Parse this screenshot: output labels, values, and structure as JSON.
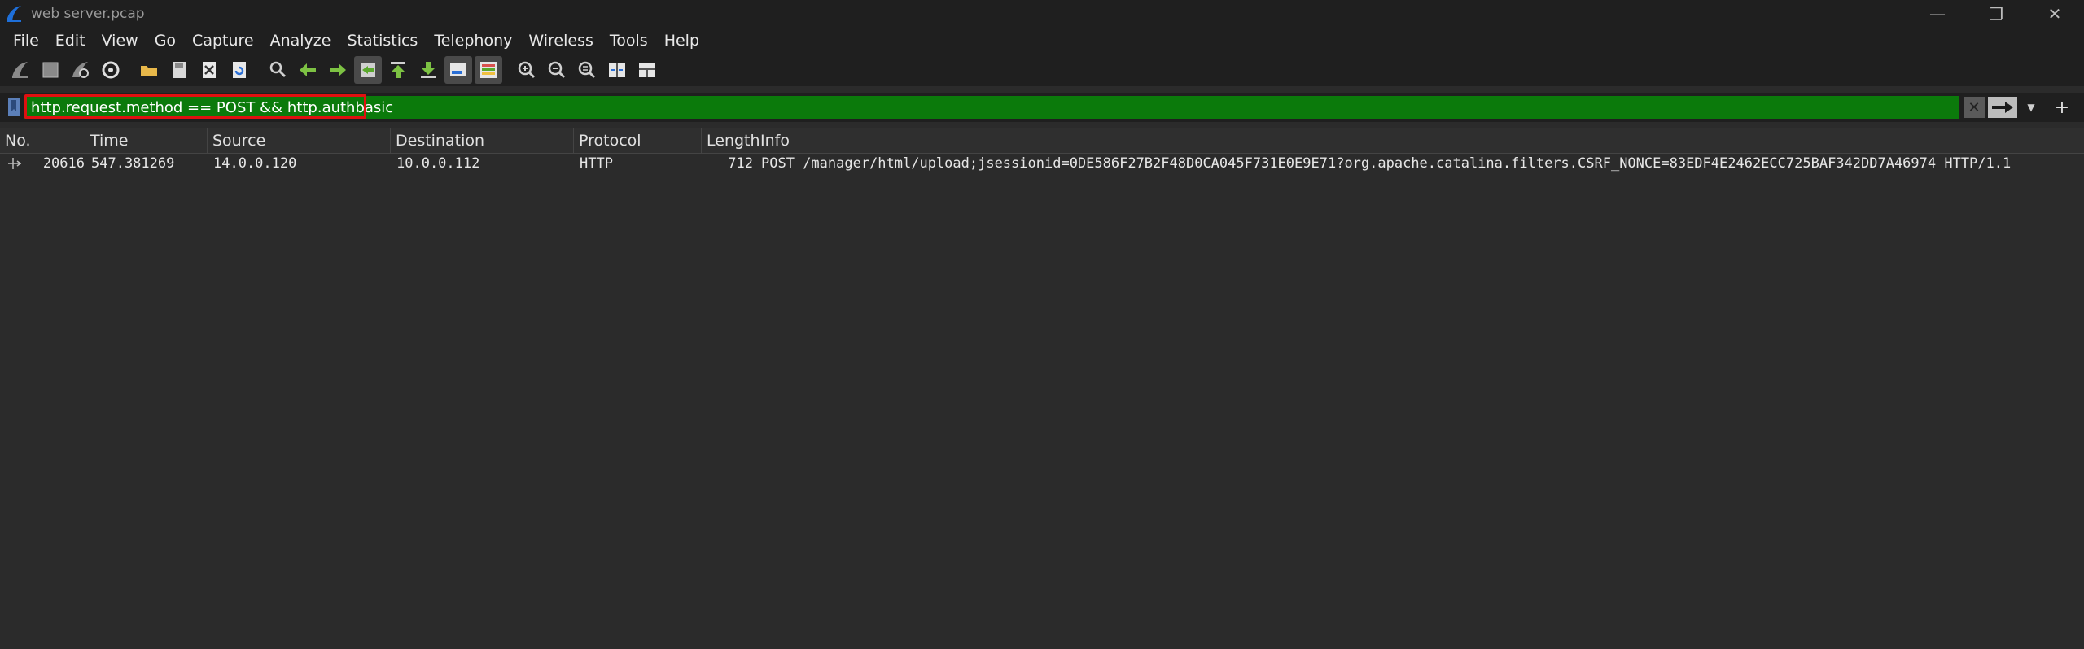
{
  "window": {
    "title": "web server.pcap",
    "controls": {
      "minimize": "—",
      "restore": "❐",
      "close": "✕"
    }
  },
  "menu": [
    "File",
    "Edit",
    "View",
    "Go",
    "Capture",
    "Analyze",
    "Statistics",
    "Telephony",
    "Wireless",
    "Tools",
    "Help"
  ],
  "toolbar": {
    "icons": [
      "shark-fin-start-icon",
      "stop-square-icon",
      "shark-fin-restart-icon",
      "capture-options-gear-icon",
      "open-folder-icon",
      "save-file-icon",
      "close-file-icon",
      "reload-file-icon",
      "find-packet-icon",
      "go-back-arrow-icon",
      "go-forward-arrow-icon",
      "go-to-packet-icon",
      "go-first-packet-icon",
      "go-last-packet-icon",
      "autoscroll-icon",
      "colorize-icon",
      "zoom-in-icon",
      "zoom-out-icon",
      "zoom-normal-icon",
      "resize-columns-icon",
      "layout-icon"
    ]
  },
  "filter": {
    "value": "http.request.method == POST && http.authbasic",
    "bg_color": "#0b7a0b",
    "highlight_color": "#e01010"
  },
  "packet_list": {
    "columns": [
      "No.",
      "Time",
      "Source",
      "Destination",
      "Protocol",
      "Length",
      "Info"
    ],
    "rows": [
      {
        "no": "20616",
        "time": "547.381269",
        "source": "14.0.0.120",
        "destination": "10.0.0.112",
        "protocol": "HTTP",
        "length": "712",
        "info": "POST /manager/html/upload;jsessionid=0DE586F27B2F48D0CA045F731E0E9E71?org.apache.catalina.filters.CSRF_NONCE=83EDF4E2462ECC725BAF342DD7A46974 HTTP/1.1"
      }
    ]
  }
}
